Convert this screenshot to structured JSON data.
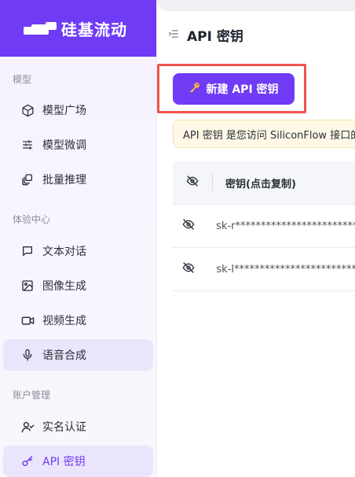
{
  "brand": {
    "name": "硅基流动"
  },
  "sidebar": {
    "sections": [
      {
        "title": "模型"
      },
      {
        "title": "体验中心"
      },
      {
        "title": "账户管理"
      }
    ],
    "items": [
      {
        "label": "模型广场",
        "icon": "cube-icon"
      },
      {
        "label": "模型微调",
        "icon": "sliders-icon"
      },
      {
        "label": "批量推理",
        "icon": "layers-icon"
      },
      {
        "label": "文本对话",
        "icon": "chat-icon"
      },
      {
        "label": "图像生成",
        "icon": "image-icon"
      },
      {
        "label": "视频生成",
        "icon": "video-icon"
      },
      {
        "label": "语音合成",
        "icon": "mic-icon"
      },
      {
        "label": "实名认证",
        "icon": "user-check-icon"
      },
      {
        "label": "API 密钥",
        "icon": "key-icon"
      }
    ]
  },
  "header": {
    "title": "API 密钥",
    "menu_icon": "collapse-menu-icon"
  },
  "actions": {
    "new_key_label": "新建 API 密钥",
    "icon": "key-emoji-icon"
  },
  "notice": {
    "text": "API 密钥 是您访问 SiliconFlow 接口的"
  },
  "table": {
    "column_header": "密钥(点击复制)",
    "rows": [
      {
        "key": "sk-r*******************************"
      },
      {
        "key": "sk-l*******************************"
      }
    ]
  },
  "colors": {
    "brand": "#6f3bf5",
    "highlight": "#ef5350",
    "notice_bg": "#fff8e6"
  }
}
